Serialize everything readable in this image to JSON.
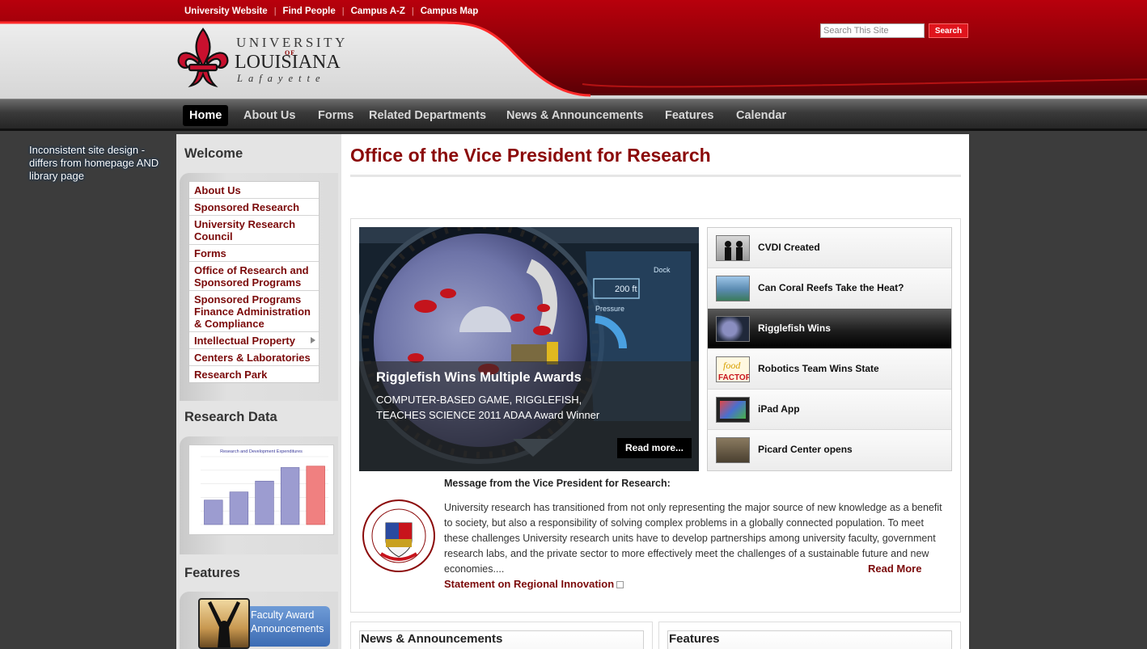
{
  "top_links": [
    "University Website",
    "Find People",
    "Campus A-Z",
    "Campus Map"
  ],
  "logo": {
    "line1": "UNIVERSITY",
    "line2": "OF",
    "line3": "LOUISIANA",
    "line4": "Lafayette"
  },
  "search": {
    "placeholder": "Search This Site",
    "button": "Search"
  },
  "nav": {
    "items": [
      "Home",
      "About Us",
      "Forms",
      "Related Departments",
      "News & Announcements",
      "Features",
      "Calendar"
    ],
    "active": "Home"
  },
  "annotation": "Inconsistent site design - differs from homepage AND library page",
  "sidebar": {
    "welcome_heading": "Welcome",
    "menu": [
      "About Us",
      "Sponsored Research",
      "University Research Council",
      "Forms",
      "Office of Research and Sponsored Programs",
      "Sponsored Programs Finance Administration & Compliance",
      "Intellectual Property",
      "Centers & Laboratories",
      "Research Park"
    ],
    "research_data_heading": "Research Data",
    "features_heading": "Features",
    "feature_card": {
      "line1": "Faculty Award",
      "line2": "Announcements"
    }
  },
  "chart_data": {
    "type": "bar",
    "title": "Research and Development Expenditures",
    "categories": [
      "",
      "",
      "",
      "",
      ""
    ],
    "values": [
      36,
      48,
      64,
      84,
      86
    ],
    "highlight_index": 4
  },
  "main": {
    "title": "Office of the Vice President for Research",
    "slide": {
      "title": "Rigglefish Wins Multiple Awards",
      "description": "COMPUTER-BASED GAME, RIGGLEFISH, TEACHES SCIENCE 2011 ADAA Award Winner",
      "read_more": "Read more...",
      "hud_depth": "200 ft",
      "hud_dock": "Dock",
      "hud_pressure": "Pressure"
    },
    "thumbs": [
      {
        "label": "CVDI Created"
      },
      {
        "label": "Can Coral Reefs Take the Heat?"
      },
      {
        "label": "Rigglefish Wins"
      },
      {
        "label": "Robotics Team Wins State"
      },
      {
        "label": "iPad App"
      },
      {
        "label": "Picard Center opens"
      }
    ],
    "active_thumb": 2,
    "message": {
      "heading": "Message from the Vice President for Research:",
      "body": "University research has transitioned from not only representing the major source of new knowledge as a benefit to society, but also a responsibility of solving complex problems in a globally connected population. To meet these challenges University research units have to develop partnerships among university faculty, government research labs, and the private sector to more effectively meet the challenges of a sustainable future and new economies....",
      "read_more": "Read More",
      "statement_link": "Statement on Regional Innovation"
    },
    "bottom_boxes": [
      "News & Announcements",
      "Features"
    ]
  },
  "colors": {
    "brand_red": "#e0141c",
    "link_maroon": "#7b0a0a",
    "title_red": "#8b0a0a"
  }
}
